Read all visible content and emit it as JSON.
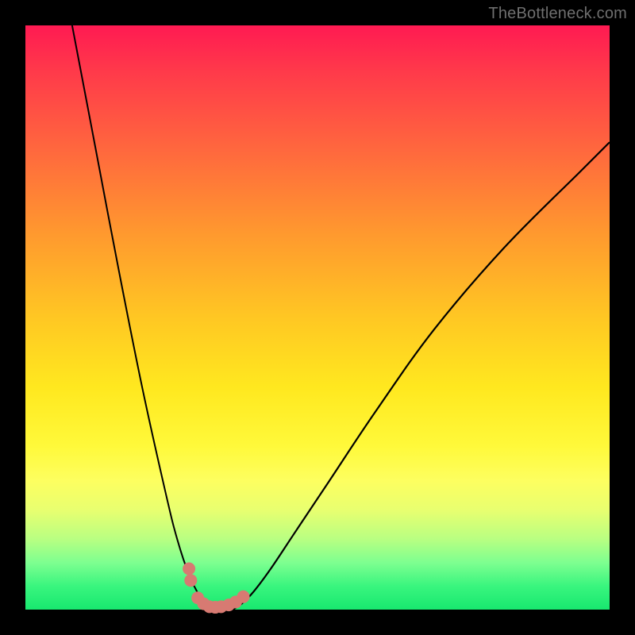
{
  "watermark": "TheBottleneck.com",
  "chart_data": {
    "type": "line",
    "title": "",
    "xlabel": "",
    "ylabel": "",
    "xlim": [
      0,
      100
    ],
    "ylim": [
      0,
      100
    ],
    "background_gradient": {
      "top": "#ff1a52",
      "bottom": "#18e86f"
    },
    "series": [
      {
        "name": "left-curve",
        "x": [
          8,
          12,
          16,
          20,
          24,
          26,
          28,
          30,
          31,
          32.5
        ],
        "y": [
          100,
          79,
          58,
          38,
          20,
          12,
          6,
          2,
          1,
          0
        ]
      },
      {
        "name": "right-curve",
        "x": [
          35.5,
          37,
          39,
          42,
          46,
          52,
          60,
          70,
          82,
          95,
          100
        ],
        "y": [
          0,
          1,
          3,
          7,
          13,
          22,
          34,
          48,
          62,
          75,
          80
        ]
      }
    ],
    "markers": {
      "name": "marker-points",
      "x": [
        28.0,
        28.3,
        29.5,
        30.5,
        31.5,
        32.5,
        33.5,
        34.8,
        36.0,
        37.3
      ],
      "y": [
        7.0,
        5.0,
        2.0,
        1.0,
        0.5,
        0.4,
        0.5,
        0.8,
        1.3,
        2.2
      ]
    }
  }
}
